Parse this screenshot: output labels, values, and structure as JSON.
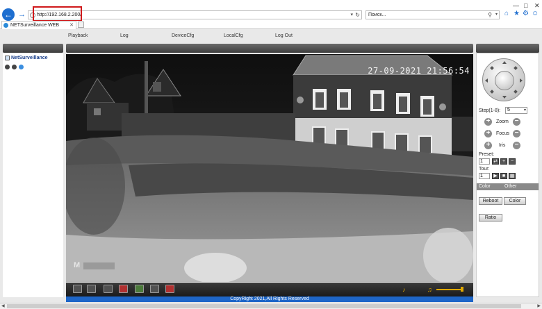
{
  "browser": {
    "url": "http://192.168.2.200/",
    "search_placeholder": "Поиск...",
    "tab_title": "NETSurveillance WEB",
    "accent_color": "#1f6fd0",
    "highlight_color": "#d0191b"
  },
  "menu": {
    "items": [
      "Playback",
      "Log",
      "DeviceCfg",
      "LocalCfg",
      "Log Out"
    ]
  },
  "left_panel": {
    "title": "NetSurveillance"
  },
  "video": {
    "osd_timestamp": "27-09-2021  21:56:54",
    "osd_channel": "M"
  },
  "ptz": {
    "step_label": "Step(1-8):",
    "step_value": "5",
    "zoom_label": "Zoom",
    "focus_label": "Focus",
    "iris_label": "Iris",
    "preset_label": "Preset:",
    "preset_value": "1",
    "tour_label": "Tour:",
    "tour_value": "1",
    "tab_color": "Color",
    "tab_other": "Other",
    "reboot_label": "Reboot",
    "color_label": "Color",
    "ratio_label": "Ratio"
  },
  "footer": {
    "copyright": "CopyRight 2021,All Rights Reserved"
  }
}
